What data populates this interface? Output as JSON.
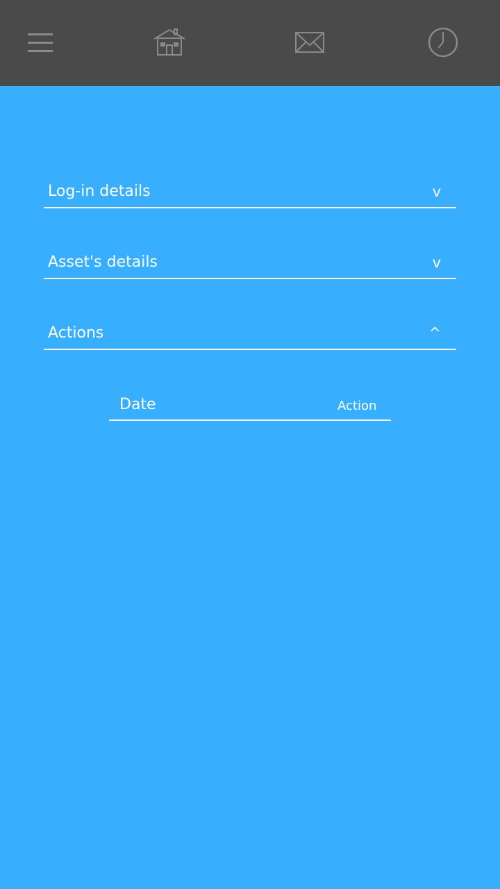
{
  "header": {
    "icons": [
      "menu-icon",
      "home-icon",
      "mail-icon",
      "clock-icon"
    ],
    "background": "#4a4a4a",
    "icon_color": "#8a8a8a"
  },
  "main": {
    "background": "#38aeff",
    "sections": [
      {
        "label": "Log-in details",
        "chevron": "v"
      },
      {
        "label": "Asset's details",
        "chevron": "v"
      },
      {
        "label": "Actions",
        "chevron": "^"
      }
    ],
    "actions_table": {
      "columns": [
        "Date",
        "Action"
      ],
      "rows": []
    }
  }
}
